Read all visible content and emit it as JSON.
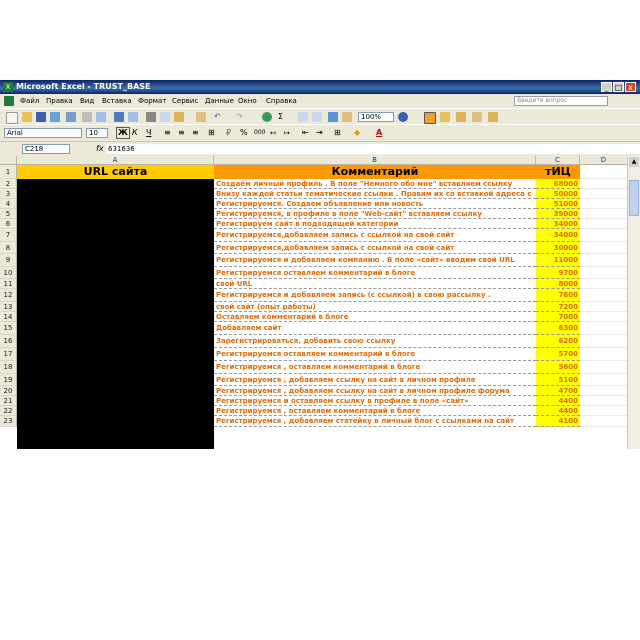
{
  "window": {
    "title": "Microsoft Excel - TRUST_BASE",
    "controls": [
      "_",
      "□",
      "x"
    ]
  },
  "menu": {
    "items": [
      "Файл",
      "Правка",
      "Вид",
      "Вставка",
      "Формат",
      "Сервис",
      "Данные",
      "Окно",
      "Справка"
    ],
    "ask_placeholder": "Введите вопрос"
  },
  "toolbar": {
    "zoom": "100%",
    "font_name": "Arial",
    "font_size": "10",
    "bold": "Ж",
    "italic": "К",
    "underline": "Ч",
    "percent": "%",
    "thousands": "000",
    "sigma": "Σ"
  },
  "formula_bar": {
    "cell_ref": "C218",
    "fx": "fx",
    "value": "631636"
  },
  "sheet": {
    "columns": [
      "A",
      "B",
      "C",
      "D"
    ],
    "header_row": {
      "row": "1",
      "a": "URL сайта",
      "b": "Комментарий",
      "c": "тИЦ"
    },
    "rows": [
      {
        "n": "2",
        "comment": "Создаём личный профиль . В поле \"Немного обо мне\" вставляем ссылку",
        "tic": "68000"
      },
      {
        "n": "3",
        "comment": "Внизу каждой статьи тематические ссылки . Правим их со вставкой адреса с",
        "tic": "50000"
      },
      {
        "n": "4",
        "comment": "Регистрируемся. Создаем объявление или новость",
        "tic": "51000"
      },
      {
        "n": "5",
        "comment": "Регистрируемся, в профиле в поле \"Web-сайт\" вставляем ссылку",
        "tic": "39000"
      },
      {
        "n": "6",
        "comment": "Регистрируем сайт в подходящей категории",
        "tic": "34000"
      },
      {
        "n": "7",
        "comment": "Регистрируемся,добавляем запись с ссылкой на свой сайт",
        "tic": "34000"
      },
      {
        "n": "8",
        "comment": "Регистрируемся,добавляем запись с ссылкой на свой сайт",
        "tic": "30000"
      },
      {
        "n": "9",
        "comment": "Регистрируемся и добавляем компанию . В поле «сайт» вводим свой URL",
        "tic": "11000"
      },
      {
        "n": "10",
        "comment": "Регистрируемся оставляем комментарий в блоге",
        "tic": "9700"
      },
      {
        "n": "11",
        "comment": "свой URL",
        "tic": "8000"
      },
      {
        "n": "12",
        "comment": "Регистрируемся и добавляем запись (с ссылкой) в свою рассылку .",
        "tic": "7600"
      },
      {
        "n": "13",
        "comment": "свой сайт (опыт работы)",
        "tic": "7200"
      },
      {
        "n": "14",
        "comment": "Оставляем комментарий в блоге",
        "tic": "7000"
      },
      {
        "n": "15",
        "comment": "Добавляем сайт",
        "tic": "6300"
      },
      {
        "n": "16",
        "comment": "Зарегистрироваться, добавить свою ссылку",
        "tic": "6200"
      },
      {
        "n": "17",
        "comment": "Регистрируемся оставляем комментарий в блоге",
        "tic": "5700"
      },
      {
        "n": "18",
        "comment": "Регистрируемся , оставляем комментарий в блоге",
        "tic": "5600"
      },
      {
        "n": "19",
        "comment": "Регистрируемся , добавляем ссылку на сайт в личном профиле",
        "tic": "5100"
      },
      {
        "n": "20",
        "comment": "Регистрируемся , добавляем ссылку на сайт в личном профиле форума",
        "tic": "4700"
      },
      {
        "n": "21",
        "comment": "Регистрируемся и оставляем ссылку в профиле в поле «сайт»",
        "tic": "4400"
      },
      {
        "n": "22",
        "comment": "Регистрируемся , оставляем комментарий в блоге",
        "tic": "4400"
      },
      {
        "n": "23",
        "comment": "Регистрируемся , добавляем статейку в личный блог с ссылками на сайт",
        "tic": "4100"
      }
    ]
  },
  "colors": {
    "header_a": "#ffcc00",
    "header_b": "#ff9900",
    "header_c": "#ff9900",
    "tic_fill": "#ffff00",
    "text_orange": "#e46c0a",
    "url_redacted": "#000000"
  }
}
